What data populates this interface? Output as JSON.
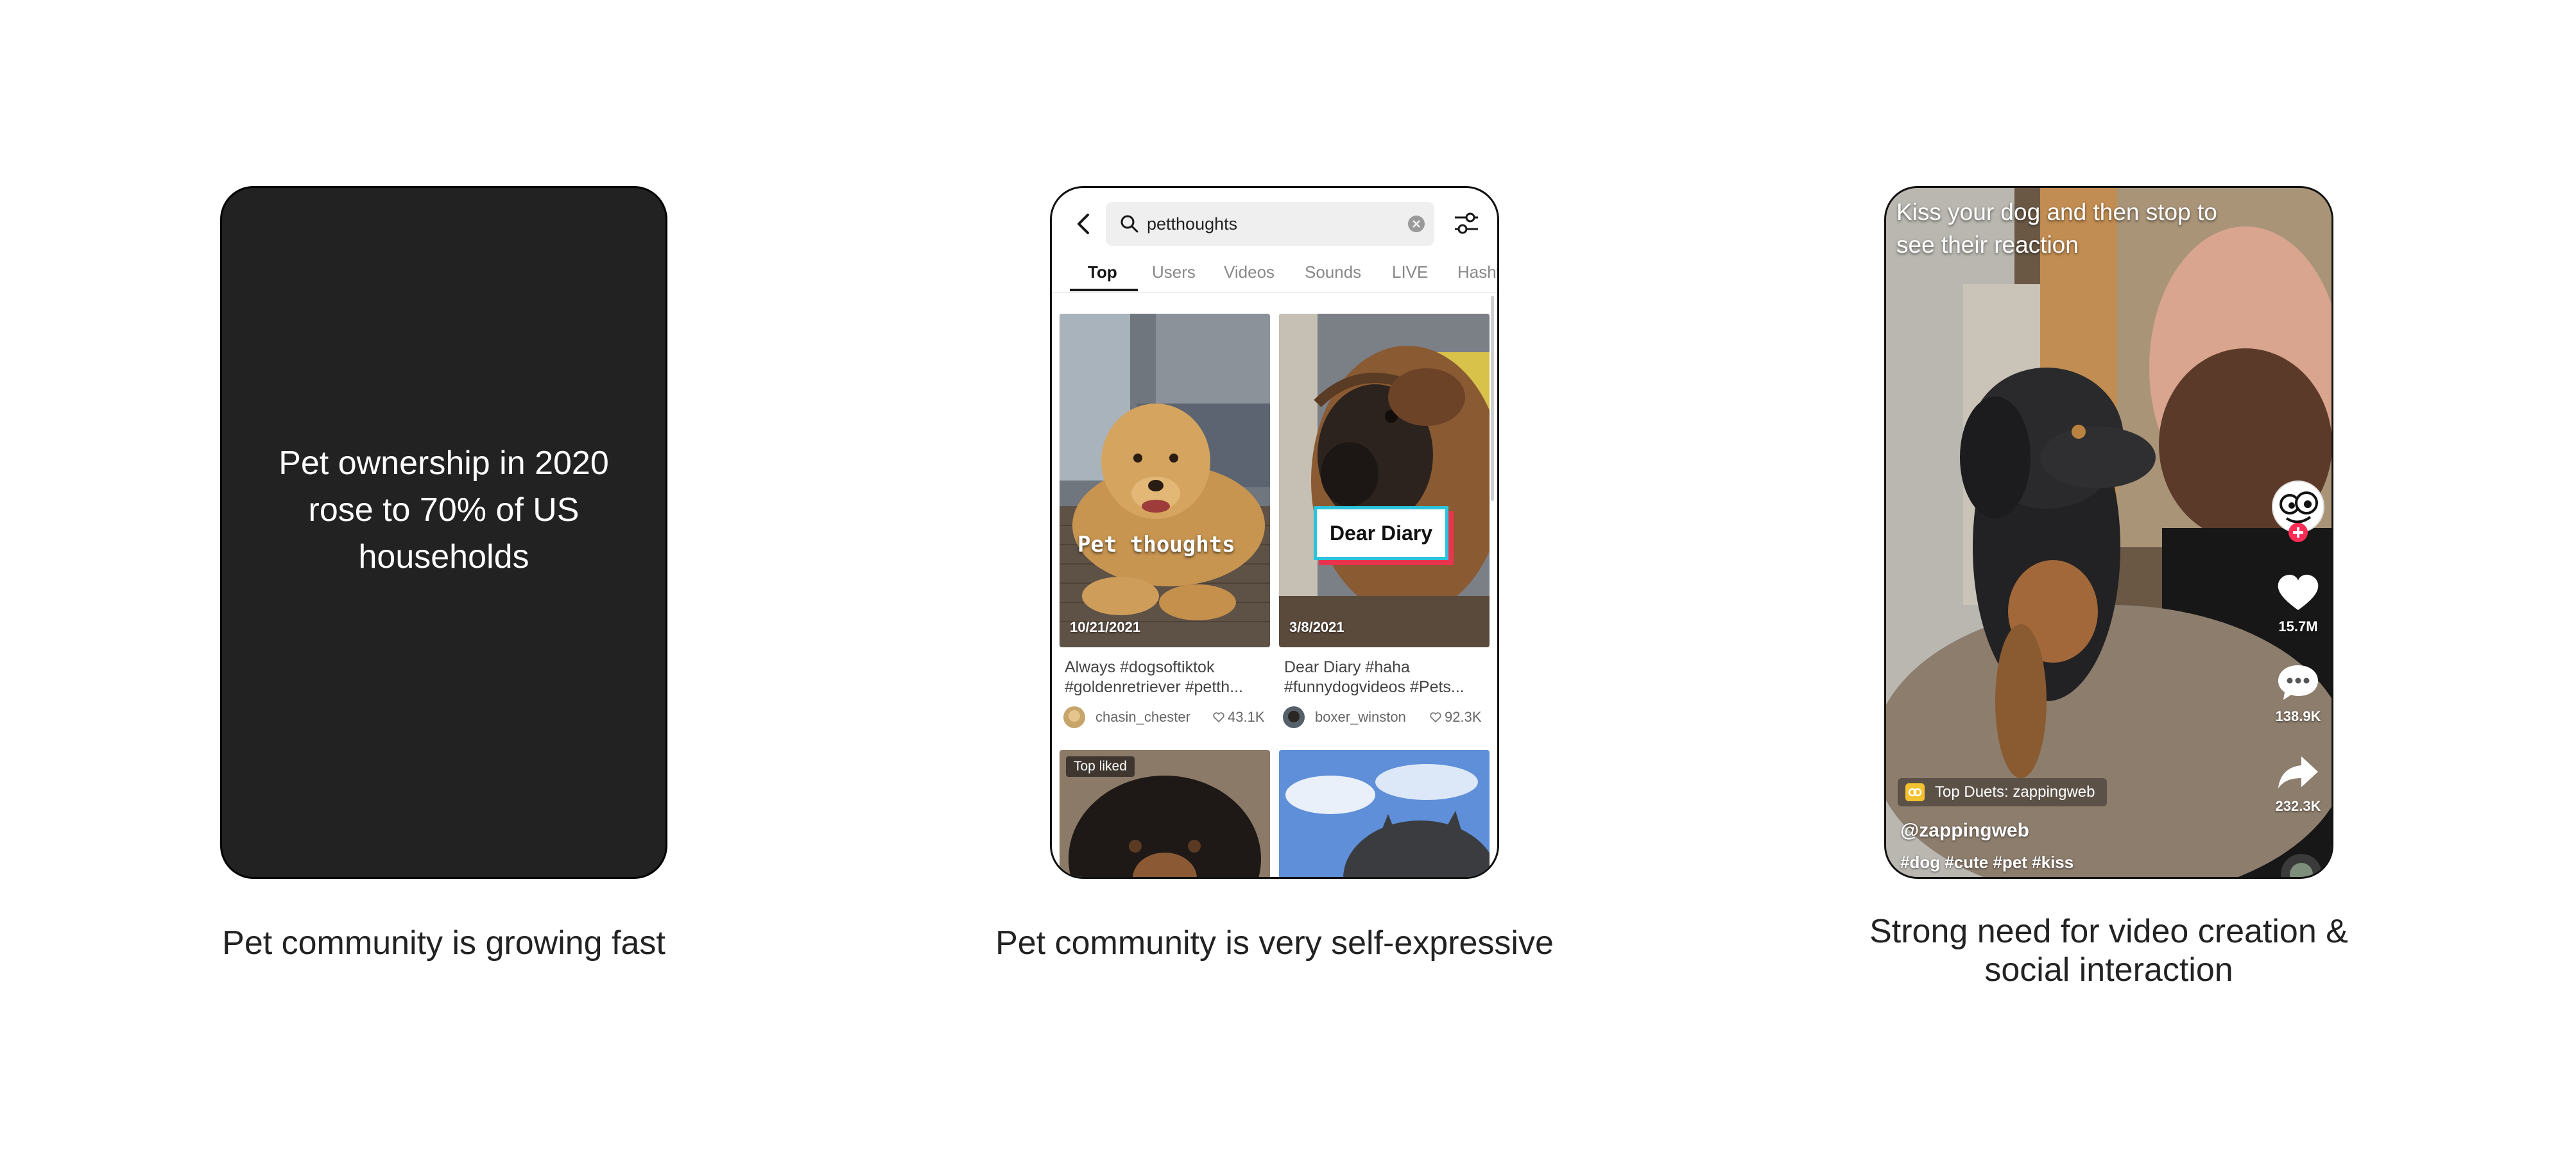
{
  "colors": {
    "dark_card": "#222222",
    "tiktok_cyan": "#2bc4dc",
    "tiktok_red": "#e8344e",
    "follow_plus": "#fe2c55"
  },
  "panel1": {
    "stat_text": "Pet ownership in 2020 rose to 70% of US households",
    "caption": "Pet community is growing fast"
  },
  "panel2": {
    "caption": "Pet community is very self-expressive",
    "search": {
      "value": "petthoughts"
    },
    "tabs": [
      {
        "label": "Top",
        "active": true
      },
      {
        "label": "Users"
      },
      {
        "label": "Videos"
      },
      {
        "label": "Sounds"
      },
      {
        "label": "LIVE"
      },
      {
        "label": "Hashtags"
      }
    ],
    "results": [
      {
        "overlay_text": "Pet thoughts",
        "date": "10/21/2021",
        "description": "Always #dogsoftiktok #goldenretriever #petth...",
        "username": "chasin_chester",
        "likes": "43.1K"
      },
      {
        "overlay_text": "Dear Diary",
        "date": "3/8/2021",
        "description": "Dear Diary #haha #funnydogvideos #Pets...",
        "username": "boxer_winston",
        "likes": "92.3K"
      },
      {
        "badge": "Top liked"
      },
      {}
    ]
  },
  "panel3": {
    "caption": "Strong need for video creation & social interaction",
    "overlay_text": "Kiss your dog and then stop to see their reaction",
    "likes": "15.7M",
    "comments": "138.9K",
    "shares": "232.3K",
    "duets_label": "Top Duets: zappingweb",
    "handle": "@zappingweb",
    "hashtags": "#dog #cute #pet #kiss"
  }
}
